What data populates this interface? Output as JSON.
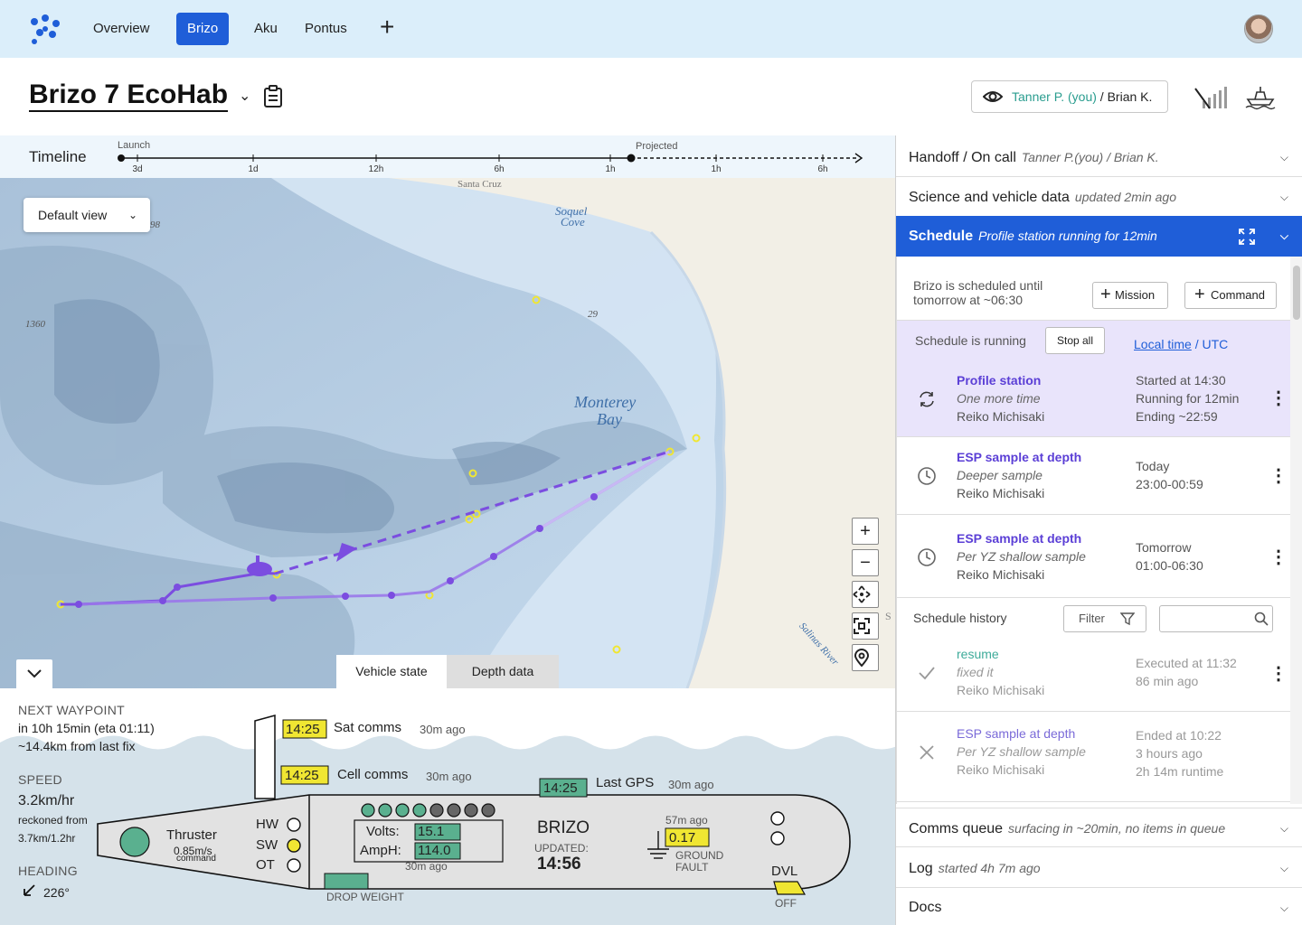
{
  "nav": {
    "tabs": [
      {
        "label": "Overview"
      },
      {
        "label": "Brizo"
      },
      {
        "label": "Aku"
      },
      {
        "label": "Pontus"
      }
    ],
    "add_symbol": "+"
  },
  "header": {
    "title": "Brizo 7 EcoHab",
    "watchers": {
      "me": "Tanner P. (you)",
      "sep": " / ",
      "other": "Brian K."
    }
  },
  "timeline": {
    "label": "Timeline",
    "launch": "Launch",
    "projected": "Projected",
    "ticks": [
      "3d",
      "1d",
      "12h",
      "6h",
      "1h",
      "1h",
      "6h"
    ]
  },
  "map": {
    "default_view": "Default view",
    "labels": {
      "santa_cruz": "Santa Cruz",
      "soquel_1": "Soquel",
      "soquel_2": "Cove",
      "monterey_1": "Monterey",
      "monterey_2": "Bay",
      "salinas": "Salinas River",
      "depth_29": "29",
      "depth_1360": "1360",
      "depth_98": "98",
      "edge_s": "S"
    },
    "zoom_in": "+",
    "zoom_out": "−",
    "tabs": {
      "vehicle_state": "Vehicle state",
      "depth_data": "Depth data"
    }
  },
  "vehicle": {
    "next_waypoint_label": "NEXT WAYPOINT",
    "next_waypoint_eta": "in 10h 15min (eta 01:11)",
    "next_waypoint_dist": "~14.4km from last fix",
    "speed_label": "SPEED",
    "speed_value": "3.2km/hr",
    "reckoned": "reckoned from",
    "reckoned_value": "3.7km/1.2hr",
    "heading_label": "HEADING",
    "heading_value": "226°",
    "sat_time": "14:25",
    "sat_label": "Sat comms",
    "sat_ago": "30m ago",
    "cell_time": "14:25",
    "cell_label": "Cell comms",
    "cell_ago": "30m ago",
    "gps_time": "14:25",
    "gps_label": "Last GPS",
    "gps_ago": "30m ago",
    "thruster_label": "Thruster",
    "thruster_speed": "0.85m/s",
    "thruster_cmd": "command",
    "hw": "HW",
    "sw": "SW",
    "ot": "OT",
    "volts_label": "Volts:",
    "volts_value": "15.1",
    "amph_label": "AmpH:",
    "amph_value": "114.0",
    "batt_ago": "30m ago",
    "name": "BRIZO",
    "updated_label": "UPDATED:",
    "updated_time": "14:56",
    "ground_ago": "57m ago",
    "ground_value": "0.17",
    "ground_label_1": "GROUND",
    "ground_label_2": "FAULT",
    "dvl_label": "DVL",
    "dvl_state": "OFF",
    "drop_weight": "DROP WEIGHT",
    "battery_cells_full": 4,
    "battery_cells_total": 8
  },
  "sidebar": {
    "handoff": {
      "title": "Handoff / On call",
      "sub": "Tanner P.(you) / Brian K."
    },
    "science": {
      "title": "Science and vehicle data",
      "sub": "updated 2min ago"
    },
    "schedule": {
      "title": "Schedule",
      "sub": "Profile station running for 12min"
    },
    "scheduled_until_1": "Brizo is scheduled until",
    "scheduled_until_2": "tomorrow at ~06:30",
    "mission_btn": "Mission",
    "command_btn": "Command",
    "running_label": "Schedule is running",
    "stop_all": "Stop all",
    "local_time": "Local time",
    "tz_sep": " / ",
    "utc": "UTC",
    "items": [
      {
        "title": "Profile station",
        "sub": "One more time",
        "name": "Reiko Michisaki",
        "r1": "Started at 14:30",
        "r2": "Running for 12min",
        "r3": "Ending ~22:59"
      },
      {
        "title": "ESP sample at depth",
        "sub": "Deeper sample",
        "name": "Reiko Michisaki",
        "r1": "Today",
        "r2": "23:00-00:59"
      },
      {
        "title": "ESP sample at depth",
        "sub": "Per YZ shallow sample",
        "name": "Reiko Michisaki",
        "r1": "Tomorrow",
        "r2": "01:00-06:30"
      }
    ],
    "history_label": "Schedule history",
    "filter_btn": "Filter",
    "search_placeholder": "",
    "history": [
      {
        "title": "resume",
        "sub": "fixed it",
        "name": "Reiko Michisaki",
        "r1": "Executed at 11:32",
        "r2": "86 min ago"
      },
      {
        "title": "ESP sample at depth",
        "sub": "Per YZ shallow sample",
        "name": "Reiko Michisaki",
        "r1": "Ended at 10:22",
        "r2": "3 hours ago",
        "r3": "2h 14m runtime"
      }
    ],
    "comms": {
      "title": "Comms queue",
      "sub": "surfacing in ~20min, no items in queue"
    },
    "log": {
      "title": "Log",
      "sub": "started 4h 7m ago"
    },
    "docs": {
      "title": "Docs"
    }
  },
  "colors": {
    "accent": "#1f5ed8",
    "track": "#7b4de0",
    "waypoint": "#f0e632",
    "teal": "#2a9d8f"
  }
}
